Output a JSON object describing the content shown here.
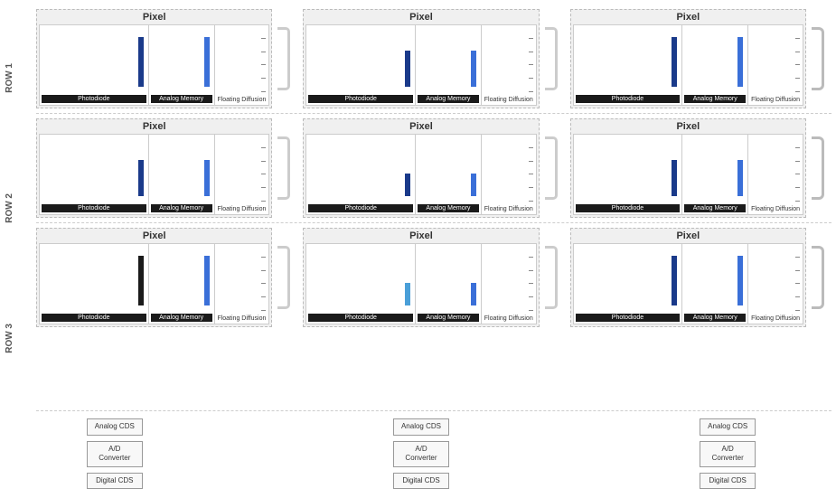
{
  "rows": [
    {
      "label": "ROW 1"
    },
    {
      "label": "ROW 2"
    },
    {
      "label": "ROW 3"
    }
  ],
  "columns": [
    {
      "id": "col1"
    },
    {
      "id": "col2"
    },
    {
      "id": "col3"
    }
  ],
  "pixel_title": "Pixel",
  "section_labels": {
    "photodiode": "Photodiode",
    "analog_memory": "Analog Memory",
    "floating_diffusion": "Floating Diffusion"
  },
  "bottom_components": [
    {
      "col": 0,
      "items": [
        {
          "label": "Analog\nCDS"
        },
        {
          "label": "A/D\nConverter"
        },
        {
          "label": "Digital\nCDS"
        }
      ]
    },
    {
      "col": 1,
      "items": [
        {
          "label": "Analog\nCDS"
        },
        {
          "label": "A/D\nConverter"
        },
        {
          "label": "Digital\nCDS"
        }
      ]
    },
    {
      "col": 2,
      "items": [
        {
          "label": "Analog\nCDS"
        },
        {
          "label": "A/D\nConverter"
        },
        {
          "label": "Digital\nCDS"
        }
      ]
    }
  ],
  "colors": {
    "blue_dark": "#1a3a8a",
    "blue_light": "#3a6fd8",
    "border": "#bbb",
    "bg_pixel": "#f0f0f0",
    "label_bg": "#1a1a1a"
  }
}
